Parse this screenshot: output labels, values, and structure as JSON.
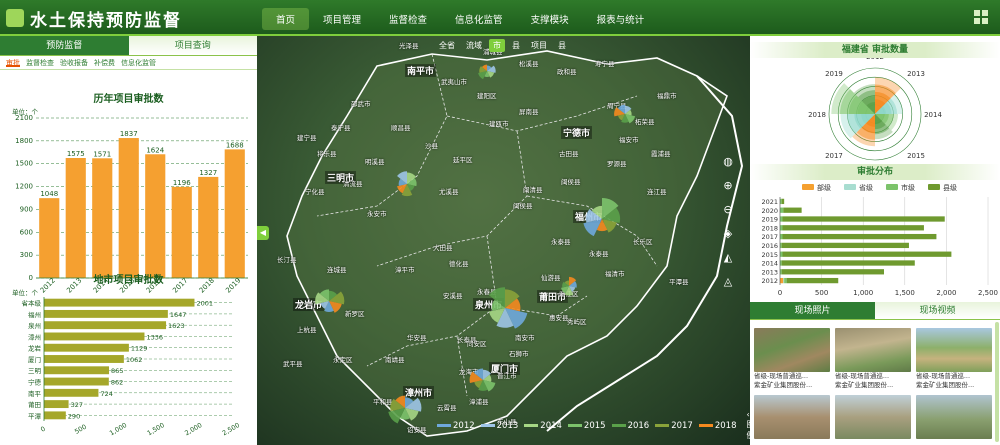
{
  "header": {
    "title": "水土保持预防监督",
    "nav": [
      "首页",
      "项目管理",
      "监督检查",
      "信息化监管",
      "支撑模块",
      "报表与统计"
    ],
    "active_nav": 0
  },
  "left": {
    "tabs": [
      "预防监督",
      "项目查询"
    ],
    "subtabs": [
      "审批",
      "监督检查",
      "验收报备",
      "补偿费",
      "信息化监管"
    ],
    "unit_label": "单位：个"
  },
  "map": {
    "filters": [
      "全省",
      "流域",
      "市",
      "县",
      "项目",
      "县"
    ],
    "active_filter": 2,
    "legend_button": "图例",
    "years": [
      "2012",
      "2013",
      "2014",
      "2015",
      "2016",
      "2017",
      "2018"
    ],
    "year_colors": [
      "#6fa8dc",
      "#9fc5e8",
      "#a6d785",
      "#7cc36b",
      "#5aa04a",
      "#8aa33a",
      "#f58a1f"
    ],
    "cities": [
      "南平市",
      "宁德市",
      "三明市",
      "福州市",
      "龙岩市",
      "泉州市",
      "莆田市",
      "漳州市",
      "厦门市"
    ],
    "counties": [
      "光泽县",
      "浦城县",
      "松溪县",
      "政和县",
      "寿宁县",
      "福鼎市",
      "柘荣县",
      "周宁县",
      "福安市",
      "霞浦县",
      "武夷山市",
      "建阳区",
      "建瓯市",
      "屏南县",
      "古田县",
      "罗源县",
      "连江县",
      "闽侯县",
      "闽清县",
      "永泰县",
      "长乐区",
      "福清市",
      "平潭县",
      "泰宁县",
      "将乐县",
      "顺昌县",
      "沙县",
      "尤溪县",
      "延平区",
      "明溪县",
      "清流县",
      "宁化县",
      "建宁县",
      "永安市",
      "大田县",
      "德化县",
      "永春县",
      "安溪县",
      "南安市",
      "惠安县",
      "仙游县",
      "长汀县",
      "连城县",
      "上杭县",
      "武平县",
      "新罗区",
      "漳平市",
      "永定区",
      "华安县",
      "长泰县",
      "南靖县",
      "平和县",
      "诏安县",
      "云霄县",
      "漳浦县",
      "东山县",
      "龙海市",
      "同安区",
      "晋江市",
      "石狮市",
      "邵武市",
      "闽侯县",
      "永泰县",
      "涵江区",
      "秀屿区"
    ]
  },
  "right": {
    "polar_title": "福建省 审批数量",
    "distribution_title": "审批分布",
    "media_tabs": [
      "现场照片",
      "现场视频"
    ],
    "photos": [
      {
        "c1": "省级-现场普通巡...",
        "c2": "紫金矿业集团股份..."
      },
      {
        "c1": "省级-现场普通巡...",
        "c2": "紫金矿业集团股份..."
      },
      {
        "c1": "省级-现场普通巡...",
        "c2": "紫金矿业集团股份..."
      },
      {
        "c1": "",
        "c2": ""
      },
      {
        "c1": "",
        "c2": ""
      },
      {
        "c1": "",
        "c2": ""
      }
    ]
  },
  "chart_data": [
    {
      "type": "bar",
      "title": "历年项目审批数",
      "categories": [
        "2012",
        "2013",
        "2014",
        "2015",
        "2016",
        "2017",
        "2018",
        "2019"
      ],
      "values": [
        1048,
        1575,
        1571,
        1837,
        1624,
        1196,
        1327,
        1688
      ],
      "ylim": [
        0,
        2100
      ],
      "yticks": [
        0,
        300,
        600,
        900,
        1200,
        1500,
        1800,
        2100
      ],
      "color": "#f5a030"
    },
    {
      "type": "bar",
      "orientation": "horizontal",
      "title": "地市项目审批数",
      "categories": [
        "省本级",
        "福州",
        "泉州",
        "漳州",
        "龙岩",
        "厦门",
        "三明",
        "宁德",
        "南平",
        "莆田",
        "平潭"
      ],
      "values": [
        2001,
        1647,
        1623,
        1336,
        1129,
        1062,
        865,
        862,
        724,
        327,
        290
      ],
      "xlim": [
        0,
        2500
      ],
      "xticks": [
        "0",
        "500",
        "1,000",
        "1,500",
        "2,000",
        "2,500"
      ],
      "color": "#a5a72a"
    },
    {
      "type": "pie",
      "variant": "polar",
      "title": "福建省 审批数量",
      "categories": [
        "2012",
        "2013",
        "2014",
        "2015",
        "2016",
        "2017",
        "2018",
        "2019"
      ],
      "colors": [
        "#f58a1f",
        "#8cd6c8",
        "#7cc36b",
        "#5aa04a"
      ],
      "values": [
        0.8,
        0.6,
        0.5,
        0.55,
        0.7,
        0.75,
        0.95,
        0.65
      ]
    },
    {
      "type": "bar",
      "orientation": "horizontal",
      "stacked": true,
      "title": "审批分布",
      "categories": [
        "2021",
        "2020",
        "2019",
        "2018",
        "2017",
        "2016",
        "2015",
        "2014",
        "2013",
        "2012"
      ],
      "legend": [
        "部级",
        "省级",
        "市级",
        "县级"
      ],
      "colors": [
        "#f5a030",
        "#a8ddd0",
        "#7cc36b",
        "#6f9a2f"
      ],
      "series": [
        {
          "name": "部级",
          "values": [
            0,
            0,
            0,
            0,
            0,
            0,
            0,
            0,
            0,
            40
          ]
        },
        {
          "name": "省级",
          "values": [
            0,
            0,
            0,
            0,
            0,
            0,
            0,
            0,
            0,
            10
          ]
        },
        {
          "name": "市级",
          "values": [
            20,
            40,
            30,
            30,
            30,
            20,
            30,
            20,
            20,
            30
          ]
        },
        {
          "name": "县级",
          "values": [
            30,
            220,
            1950,
            1700,
            1850,
            1530,
            2030,
            1600,
            1230,
            620
          ]
        }
      ],
      "xlim": [
        0,
        2500
      ],
      "xticks": [
        "0",
        "500",
        "1,000",
        "1,500",
        "2,000",
        "2,500"
      ]
    }
  ]
}
